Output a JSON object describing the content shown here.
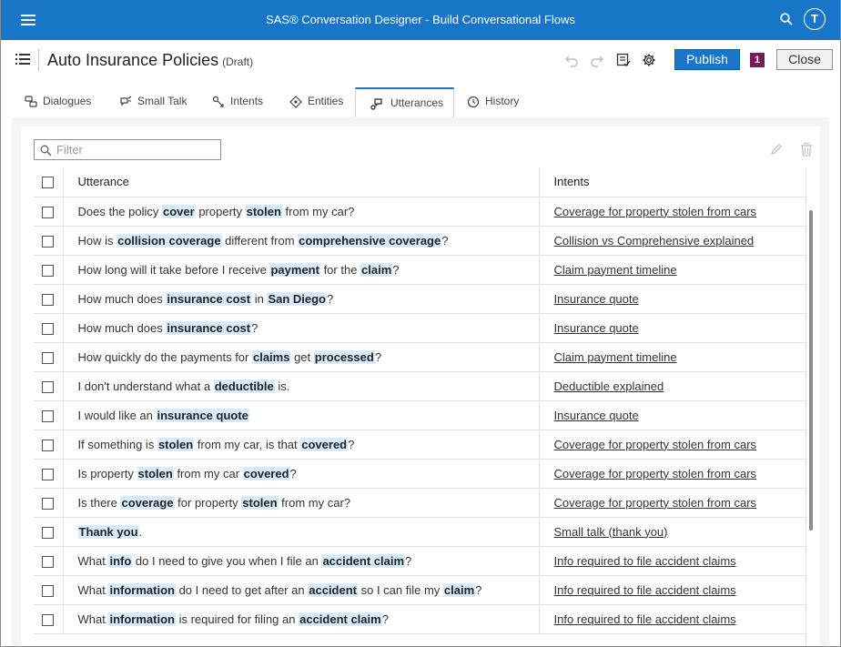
{
  "app": {
    "title": "SAS® Conversation Designer - Build Conversational Flows",
    "user_initial": "T"
  },
  "header": {
    "title": "Auto Insurance Policies",
    "status": "(Draft)",
    "publish_label": "Publish",
    "badge_count": "1",
    "close_label": "Close"
  },
  "tabs": [
    {
      "label": "Dialogues",
      "icon": "dialogues-icon"
    },
    {
      "label": "Small Talk",
      "icon": "small-talk-icon"
    },
    {
      "label": "Intents",
      "icon": "intents-icon"
    },
    {
      "label": "Entities",
      "icon": "entities-icon"
    },
    {
      "label": "Utterances",
      "icon": "utterances-icon",
      "active": true
    },
    {
      "label": "History",
      "icon": "history-icon"
    }
  ],
  "filter": {
    "placeholder": "Filter",
    "value": ""
  },
  "table": {
    "headers": {
      "utterance": "Utterance",
      "intents": "Intents"
    },
    "rows": [
      {
        "utterance": [
          [
            "Does the policy ",
            false
          ],
          [
            "cover",
            true
          ],
          [
            " property ",
            false
          ],
          [
            "stolen",
            true
          ],
          [
            " from my car?",
            false
          ]
        ],
        "intent": "Coverage for property stolen from cars"
      },
      {
        "utterance": [
          [
            "How is ",
            false
          ],
          [
            "collision coverage",
            true
          ],
          [
            " different from ",
            false
          ],
          [
            "comprehensive coverage",
            true
          ],
          [
            "?",
            false
          ]
        ],
        "intent": "Collision vs Comprehensive explained"
      },
      {
        "utterance": [
          [
            "How long will it take before I receive ",
            false
          ],
          [
            "payment",
            true
          ],
          [
            " for the ",
            false
          ],
          [
            "claim",
            true
          ],
          [
            "?",
            false
          ]
        ],
        "intent": "Claim payment timeline"
      },
      {
        "utterance": [
          [
            "How much does ",
            false
          ],
          [
            "insurance cost",
            true
          ],
          [
            " in ",
            false
          ],
          [
            "San Diego",
            true
          ],
          [
            "?",
            false
          ]
        ],
        "intent": "Insurance quote"
      },
      {
        "utterance": [
          [
            "How much does ",
            false
          ],
          [
            "insurance cost",
            true
          ],
          [
            "?",
            false
          ]
        ],
        "intent": "Insurance quote"
      },
      {
        "utterance": [
          [
            "How quickly do the payments for ",
            false
          ],
          [
            "claims",
            true
          ],
          [
            " get ",
            false
          ],
          [
            "processed",
            true
          ],
          [
            "?",
            false
          ]
        ],
        "intent": "Claim payment timeline"
      },
      {
        "utterance": [
          [
            "I don't understand what a ",
            false
          ],
          [
            "deductible",
            true
          ],
          [
            " is.",
            false
          ]
        ],
        "intent": "Deductible explained"
      },
      {
        "utterance": [
          [
            "I would like an ",
            false
          ],
          [
            "insurance quote",
            true
          ]
        ],
        "intent": "Insurance quote"
      },
      {
        "utterance": [
          [
            "If something is ",
            false
          ],
          [
            "stolen",
            true
          ],
          [
            " from my car, is that ",
            false
          ],
          [
            "covered",
            true
          ],
          [
            "?",
            false
          ]
        ],
        "intent": "Coverage for property stolen from cars"
      },
      {
        "utterance": [
          [
            "Is property ",
            false
          ],
          [
            "stolen",
            true
          ],
          [
            " from my car ",
            false
          ],
          [
            "covered",
            true
          ],
          [
            "?",
            false
          ]
        ],
        "intent": "Coverage for property stolen from cars"
      },
      {
        "utterance": [
          [
            "Is there ",
            false
          ],
          [
            "coverage",
            true
          ],
          [
            " for property ",
            false
          ],
          [
            "stolen",
            true
          ],
          [
            " from my car?",
            false
          ]
        ],
        "intent": "Coverage for property stolen from cars"
      },
      {
        "utterance": [
          [
            "Thank you",
            true
          ],
          [
            ".",
            false
          ]
        ],
        "intent": "Small talk (thank you)"
      },
      {
        "utterance": [
          [
            "What ",
            false
          ],
          [
            "info",
            true
          ],
          [
            " do I need to give you when I file an ",
            false
          ],
          [
            "accident claim",
            true
          ],
          [
            "?",
            false
          ]
        ],
        "intent": "Info required to file accident claims"
      },
      {
        "utterance": [
          [
            "What ",
            false
          ],
          [
            "information",
            true
          ],
          [
            " do I need to get after an ",
            false
          ],
          [
            "accident",
            true
          ],
          [
            " so I can file my ",
            false
          ],
          [
            "claim",
            true
          ],
          [
            "?",
            false
          ]
        ],
        "intent": "Info required to file accident claims"
      },
      {
        "utterance": [
          [
            "What ",
            false
          ],
          [
            "information",
            true
          ],
          [
            " is required for filing an ",
            false
          ],
          [
            "accident claim",
            true
          ],
          [
            "?",
            false
          ]
        ],
        "intent": "Info required to file accident claims"
      }
    ]
  },
  "colors": {
    "brand_blue": "#1776c7",
    "highlight": "#d7ebfb",
    "badge": "#7a1a54"
  }
}
